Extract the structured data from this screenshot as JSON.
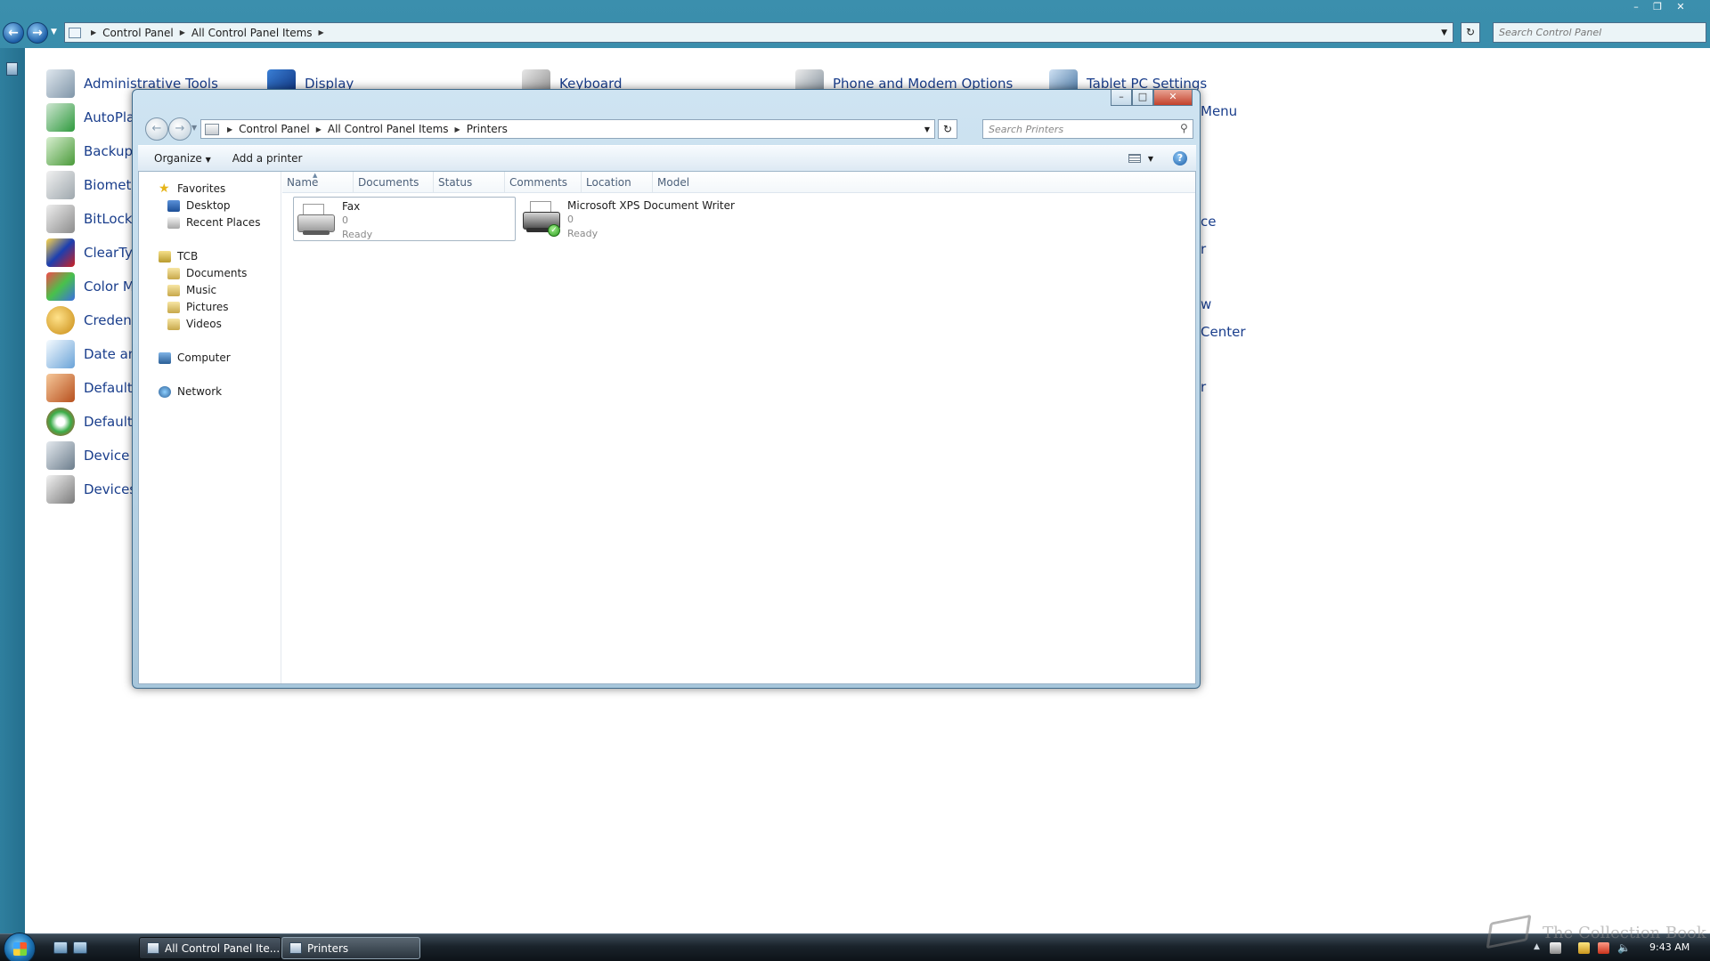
{
  "background_window": {
    "breadcrumb": [
      "Control Panel",
      "All Control Panel Items"
    ],
    "search_placeholder": "Search Control Panel",
    "items": [
      {
        "label": "Administrative Tools",
        "icon": "administrative-tools-icon"
      },
      {
        "label": "AutoPla",
        "icon": "autoplay-icon"
      },
      {
        "label": "Backup",
        "icon": "backup-icon"
      },
      {
        "label": "Biometr",
        "icon": "biometric-icon"
      },
      {
        "label": "BitLocke",
        "icon": "bitlocker-icon"
      },
      {
        "label": "ClearTy",
        "icon": "cleartype-icon"
      },
      {
        "label": "Color M",
        "icon": "color-management-icon"
      },
      {
        "label": "Credent",
        "icon": "credential-manager-icon"
      },
      {
        "label": "Date an",
        "icon": "date-time-icon"
      },
      {
        "label": "Default",
        "icon": "default-location-icon"
      },
      {
        "label": "Default",
        "icon": "default-programs-icon"
      },
      {
        "label": "Device M",
        "icon": "device-manager-icon"
      },
      {
        "label": "Devices",
        "icon": "devices-printers-icon"
      },
      {
        "label": "Display",
        "icon": "display-icon"
      },
      {
        "label": "Keyboard",
        "icon": "keyboard-icon"
      },
      {
        "label": "Phone and Modem Options",
        "icon": "phone-modem-icon"
      },
      {
        "label": "Tablet PC Settings",
        "icon": "tablet-pc-icon"
      },
      {
        "label": "Menu",
        "icon": ""
      },
      {
        "label": "ce",
        "icon": ""
      },
      {
        "label": "r",
        "icon": ""
      },
      {
        "label": "w",
        "icon": ""
      },
      {
        "label": "Center",
        "icon": ""
      },
      {
        "label": "r",
        "icon": ""
      }
    ]
  },
  "printers_window": {
    "breadcrumb": [
      "Control Panel",
      "All Control Panel Items",
      "Printers"
    ],
    "search_placeholder": "Search Printers",
    "toolbar": {
      "organize": "Organize",
      "add_printer": "Add a printer"
    },
    "nav_pane": {
      "favorites": "Favorites",
      "favorites_items": [
        "Desktop",
        "Recent Places"
      ],
      "user": "TCB",
      "user_items": [
        "Documents",
        "Music",
        "Pictures",
        "Videos"
      ],
      "computer": "Computer",
      "network": "Network"
    },
    "columns": [
      "Name",
      "Documents",
      "Status",
      "Comments",
      "Location",
      "Model"
    ],
    "printers": [
      {
        "name": "Fax",
        "documents": "0",
        "status": "Ready",
        "selected": true
      },
      {
        "name": "Microsoft XPS Document Writer",
        "documents": "0",
        "status": "Ready",
        "default": true
      }
    ]
  },
  "taskbar": {
    "buttons": [
      {
        "label": "All Control Panel Ite...",
        "active": false
      },
      {
        "label": "Printers",
        "active": true
      }
    ],
    "clock": "9:43 AM"
  },
  "watermark": "The Collection Book"
}
